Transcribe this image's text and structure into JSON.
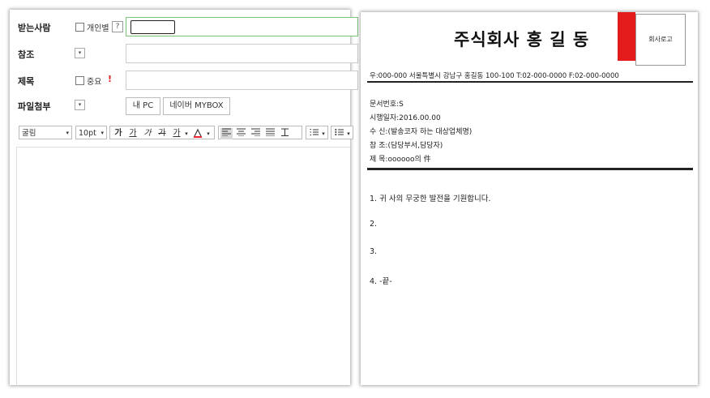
{
  "compose": {
    "to_label": "받는사람",
    "individual_label": "개인별",
    "help_symbol": "?",
    "cc_label": "참조",
    "subject_label": "제목",
    "important_label": "중요",
    "important_mark": "!",
    "attach_label": "파일첨부",
    "my_pc_button": "내 PC",
    "mybox_button": "네이버 MYBOX",
    "dropdown_symbol": "▾"
  },
  "toolbar": {
    "font": "굴림",
    "size": "10pt",
    "bold": "가",
    "underline": "가",
    "italic": "가",
    "strike": "가",
    "text_color": "가",
    "dropdown_symbol": "▾"
  },
  "document": {
    "company_title": "주식회사 홍 길 동",
    "logo_text": "회사로고",
    "address_line": "우:000-000   서울특별시 강남구 홍길동 100-100   T:02-000-0000   F:02-000-0000",
    "doc_number": "문서번호:S",
    "issue_date": "시행일자:2016.00.00",
    "recipient": "수      신:(발송코자 하는 대상업체명)",
    "reference": "참      조:(담당부서,담당자)",
    "subject": "제      목:oooooo의 件",
    "lines": [
      "1. 귀 사의 무궁한 발전을 기원합니다.",
      "2.",
      "3.",
      "4. -끝-"
    ]
  }
}
